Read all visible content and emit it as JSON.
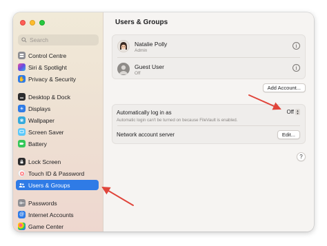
{
  "window": {
    "title": "Users & Groups"
  },
  "sidebar": {
    "search_placeholder": "Search",
    "items": [
      {
        "label": "Control Centre",
        "icon": "control-centre-icon",
        "color": "#8e8e93"
      },
      {
        "label": "Siri & Spotlight",
        "icon": "siri-icon",
        "color": "#b34bd1"
      },
      {
        "label": "Privacy & Security",
        "icon": "hand-icon",
        "color": "#2f7be6"
      },
      {
        "label": "Desktop & Dock",
        "icon": "dock-icon",
        "color": "#1d1d1f"
      },
      {
        "label": "Displays",
        "icon": "display-icon",
        "color": "#2f7be6"
      },
      {
        "label": "Wallpaper",
        "icon": "wallpaper-icon",
        "color": "#34aadc"
      },
      {
        "label": "Screen Saver",
        "icon": "screen-saver-icon",
        "color": "#5ac8fa"
      },
      {
        "label": "Battery",
        "icon": "battery-icon",
        "color": "#34c759"
      },
      {
        "label": "Lock Screen",
        "icon": "lock-icon",
        "color": "#1d1d1f"
      },
      {
        "label": "Touch ID & Password",
        "icon": "fingerprint-icon",
        "color": "#ff6b6b"
      },
      {
        "label": "Users & Groups",
        "icon": "users-icon",
        "color": "#2f7be6",
        "active": true
      },
      {
        "label": "Passwords",
        "icon": "key-icon",
        "color": "#8e8e93"
      },
      {
        "label": "Internet Accounts",
        "icon": "at-icon",
        "color": "#2f7be6"
      },
      {
        "label": "Game Center",
        "icon": "game-center-icon",
        "color": "#ff9f0a"
      }
    ]
  },
  "main": {
    "title": "Users & Groups",
    "users": [
      {
        "name": "Natalie Polly",
        "role": "Admin"
      },
      {
        "name": "Guest User",
        "role": "Off"
      }
    ],
    "add_account_label": "Add Account...",
    "auto_login": {
      "label": "Automatically log in as",
      "value": "Off",
      "note": "Automatic login can't be turned on because FileVault is enabled."
    },
    "network_server": {
      "label": "Network account server",
      "button": "Edit..."
    },
    "help_label": "?"
  },
  "colors": {
    "accent": "#2f7be6",
    "annotation_arrow": "#e0453b"
  }
}
